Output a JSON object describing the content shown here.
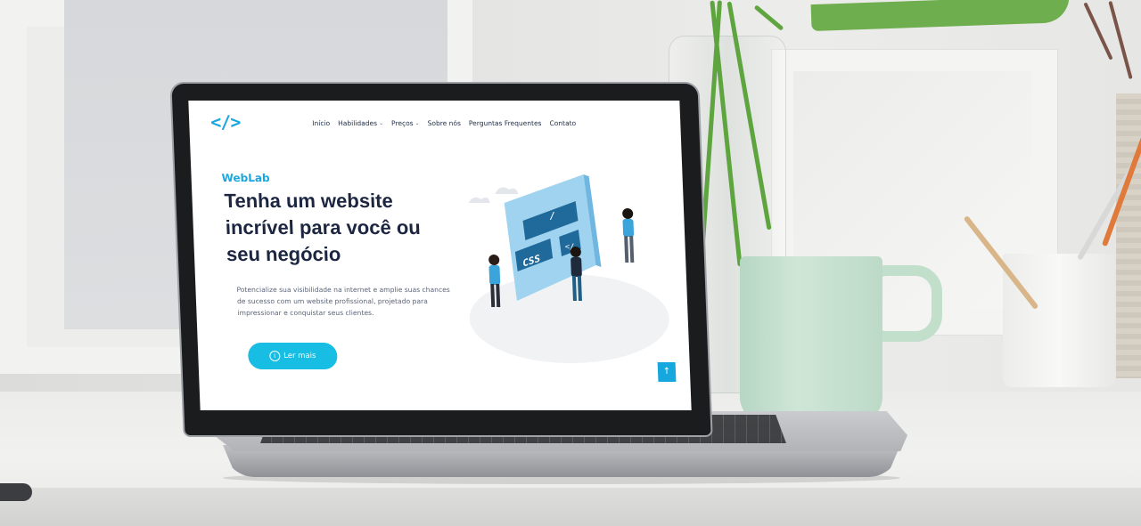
{
  "site": {
    "logo": "</>",
    "brand": "WebLab",
    "nav": [
      {
        "label": "Início",
        "dropdown": false
      },
      {
        "label": "Habilidades",
        "dropdown": true
      },
      {
        "label": "Preços",
        "dropdown": true
      },
      {
        "label": "Sobre nós",
        "dropdown": false
      },
      {
        "label": "Perguntas Frequentes",
        "dropdown": false
      },
      {
        "label": "Contato",
        "dropdown": false
      }
    ],
    "headline": "Tenha um website incrível para você ou seu negócio",
    "description": "Potencialize sua visibilidade na internet e amplie suas chances de sucesso com um website profissional, projetado para impressionar e conquistar seus clientes.",
    "cta_label": "Ler mais",
    "cta_icon": "info-icon",
    "back_to_top_icon": "arrow-up-icon",
    "illustration_labels": {
      "css": "CSS",
      "slash": "/",
      "partial": "</"
    }
  },
  "colors": {
    "accent": "#17bde3",
    "brand": "#18a6de",
    "headline": "#1c2640",
    "mug": "#c2dfcc",
    "leaf": "#6fae4f"
  }
}
